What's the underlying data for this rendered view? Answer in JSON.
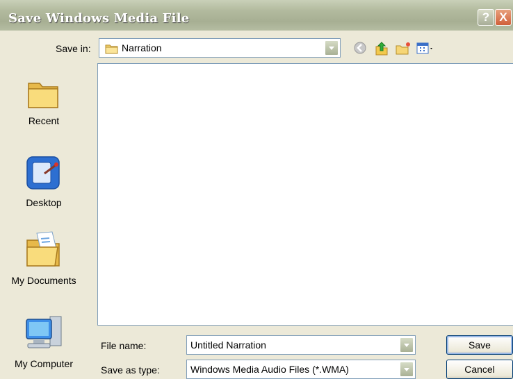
{
  "window": {
    "title": "Save Windows Media File"
  },
  "titlebar_buttons": {
    "help_label": "?",
    "close_label": "X"
  },
  "toolbar": {
    "save_in_label": "Save in:",
    "save_in_value": "Narration",
    "icons": [
      "back-icon",
      "up-folder-icon",
      "new-folder-icon",
      "view-menu-icon"
    ]
  },
  "places": [
    {
      "label": "Recent",
      "icon": "recent-folder-icon"
    },
    {
      "label": "Desktop",
      "icon": "desktop-icon"
    },
    {
      "label": "My Documents",
      "icon": "my-documents-icon"
    },
    {
      "label": "My Computer",
      "icon": "my-computer-icon"
    }
  ],
  "file_name": {
    "label": "File name:",
    "value": "Untitled Narration"
  },
  "save_as_type": {
    "label": "Save as type:",
    "value": "Windows Media Audio Files (*.WMA)"
  },
  "buttons": {
    "save": "Save",
    "cancel": "Cancel"
  },
  "colors": {
    "titlebar": "#b2ba9e",
    "dialog_bg": "#ece9d8",
    "border": "#7f9db9",
    "button_border": "#003c74"
  }
}
